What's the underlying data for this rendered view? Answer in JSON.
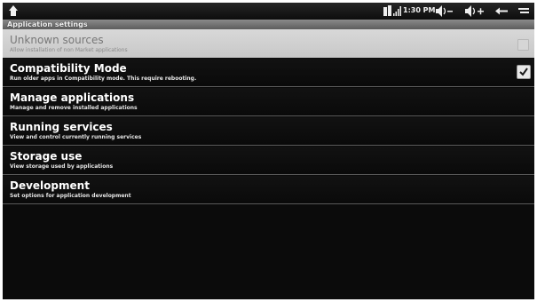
{
  "status_bar": {
    "time": "1:30 PM",
    "icons": [
      "home-icon",
      "notification-icon",
      "signal-icon",
      "volume-down-icon",
      "volume-up-icon",
      "back-icon",
      "menu-icon"
    ]
  },
  "screen_title": "Application settings",
  "unknown_sources": {
    "title": "Unknown sources",
    "summary": "Allow installation of non Market applications",
    "checked": false,
    "enabled": false
  },
  "items": [
    {
      "title": "Compatibility Mode",
      "summary": "Run older apps in Compatibility mode. This require rebooting.",
      "checked": true
    },
    {
      "title": "Manage applications",
      "summary": "Manage and remove installed applications"
    },
    {
      "title": "Running services",
      "summary": "View and control currently running services"
    },
    {
      "title": "Storage use",
      "summary": "View storage used by applications"
    },
    {
      "title": "Development",
      "summary": "Set options for application development"
    }
  ]
}
